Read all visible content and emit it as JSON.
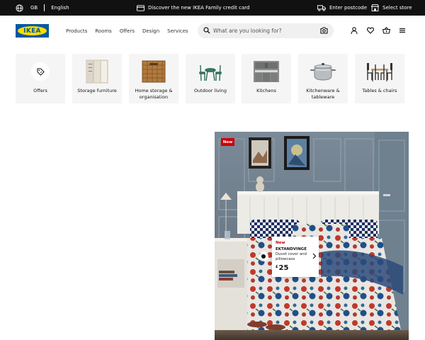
{
  "topbar": {
    "country": "GB",
    "language": "English",
    "promo": "Discover the new IKEA Family credit card",
    "postcode": "Enter postcode",
    "store": "Select store"
  },
  "header": {
    "logo_text": "IKEA",
    "nav": [
      "Products",
      "Rooms",
      "Offers",
      "Design",
      "Services"
    ],
    "search_placeholder": "What are you looking for?"
  },
  "categories": [
    {
      "label": "Offers",
      "icon": "offer-tag-icon"
    },
    {
      "label": "Storage furniture",
      "icon": "wardrobe-image"
    },
    {
      "label": "Home storage & organisation",
      "icon": "basket-image"
    },
    {
      "label": "Outdoor living",
      "icon": "patio-set-image"
    },
    {
      "label": "Kitchens",
      "icon": "kitchen-image"
    },
    {
      "label": "Kitchenware & tableware",
      "icon": "pot-image"
    },
    {
      "label": "Tables & chairs",
      "icon": "dining-set-image"
    }
  ],
  "hero": {
    "badge": "New",
    "product": {
      "tag": "New",
      "name": "EKTANDVINGE",
      "description": "Duvet cover and pillowcase",
      "currency": "£",
      "price": "25"
    }
  },
  "colors": {
    "brand_blue": "#0058a3",
    "brand_yellow": "#ffdb00",
    "new_red": "#cc0008",
    "topbar_bg": "#111111"
  }
}
